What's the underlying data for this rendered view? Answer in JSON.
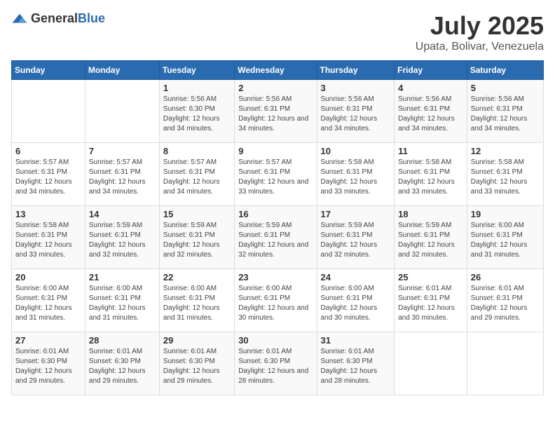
{
  "header": {
    "logo_general": "General",
    "logo_blue": "Blue",
    "month": "July 2025",
    "location": "Upata, Bolivar, Venezuela"
  },
  "weekdays": [
    "Sunday",
    "Monday",
    "Tuesday",
    "Wednesday",
    "Thursday",
    "Friday",
    "Saturday"
  ],
  "weeks": [
    [
      {
        "day": "",
        "info": ""
      },
      {
        "day": "",
        "info": ""
      },
      {
        "day": "1",
        "info": "Sunrise: 5:56 AM\nSunset: 6:30 PM\nDaylight: 12 hours and 34 minutes."
      },
      {
        "day": "2",
        "info": "Sunrise: 5:56 AM\nSunset: 6:31 PM\nDaylight: 12 hours and 34 minutes."
      },
      {
        "day": "3",
        "info": "Sunrise: 5:56 AM\nSunset: 6:31 PM\nDaylight: 12 hours and 34 minutes."
      },
      {
        "day": "4",
        "info": "Sunrise: 5:56 AM\nSunset: 6:31 PM\nDaylight: 12 hours and 34 minutes."
      },
      {
        "day": "5",
        "info": "Sunrise: 5:56 AM\nSunset: 6:31 PM\nDaylight: 12 hours and 34 minutes."
      }
    ],
    [
      {
        "day": "6",
        "info": "Sunrise: 5:57 AM\nSunset: 6:31 PM\nDaylight: 12 hours and 34 minutes."
      },
      {
        "day": "7",
        "info": "Sunrise: 5:57 AM\nSunset: 6:31 PM\nDaylight: 12 hours and 34 minutes."
      },
      {
        "day": "8",
        "info": "Sunrise: 5:57 AM\nSunset: 6:31 PM\nDaylight: 12 hours and 34 minutes."
      },
      {
        "day": "9",
        "info": "Sunrise: 5:57 AM\nSunset: 6:31 PM\nDaylight: 12 hours and 33 minutes."
      },
      {
        "day": "10",
        "info": "Sunrise: 5:58 AM\nSunset: 6:31 PM\nDaylight: 12 hours and 33 minutes."
      },
      {
        "day": "11",
        "info": "Sunrise: 5:58 AM\nSunset: 6:31 PM\nDaylight: 12 hours and 33 minutes."
      },
      {
        "day": "12",
        "info": "Sunrise: 5:58 AM\nSunset: 6:31 PM\nDaylight: 12 hours and 33 minutes."
      }
    ],
    [
      {
        "day": "13",
        "info": "Sunrise: 5:58 AM\nSunset: 6:31 PM\nDaylight: 12 hours and 33 minutes."
      },
      {
        "day": "14",
        "info": "Sunrise: 5:59 AM\nSunset: 6:31 PM\nDaylight: 12 hours and 32 minutes."
      },
      {
        "day": "15",
        "info": "Sunrise: 5:59 AM\nSunset: 6:31 PM\nDaylight: 12 hours and 32 minutes."
      },
      {
        "day": "16",
        "info": "Sunrise: 5:59 AM\nSunset: 6:31 PM\nDaylight: 12 hours and 32 minutes."
      },
      {
        "day": "17",
        "info": "Sunrise: 5:59 AM\nSunset: 6:31 PM\nDaylight: 12 hours and 32 minutes."
      },
      {
        "day": "18",
        "info": "Sunrise: 5:59 AM\nSunset: 6:31 PM\nDaylight: 12 hours and 32 minutes."
      },
      {
        "day": "19",
        "info": "Sunrise: 6:00 AM\nSunset: 6:31 PM\nDaylight: 12 hours and 31 minutes."
      }
    ],
    [
      {
        "day": "20",
        "info": "Sunrise: 6:00 AM\nSunset: 6:31 PM\nDaylight: 12 hours and 31 minutes."
      },
      {
        "day": "21",
        "info": "Sunrise: 6:00 AM\nSunset: 6:31 PM\nDaylight: 12 hours and 31 minutes."
      },
      {
        "day": "22",
        "info": "Sunrise: 6:00 AM\nSunset: 6:31 PM\nDaylight: 12 hours and 31 minutes."
      },
      {
        "day": "23",
        "info": "Sunrise: 6:00 AM\nSunset: 6:31 PM\nDaylight: 12 hours and 30 minutes."
      },
      {
        "day": "24",
        "info": "Sunrise: 6:00 AM\nSunset: 6:31 PM\nDaylight: 12 hours and 30 minutes."
      },
      {
        "day": "25",
        "info": "Sunrise: 6:01 AM\nSunset: 6:31 PM\nDaylight: 12 hours and 30 minutes."
      },
      {
        "day": "26",
        "info": "Sunrise: 6:01 AM\nSunset: 6:31 PM\nDaylight: 12 hours and 29 minutes."
      }
    ],
    [
      {
        "day": "27",
        "info": "Sunrise: 6:01 AM\nSunset: 6:30 PM\nDaylight: 12 hours and 29 minutes."
      },
      {
        "day": "28",
        "info": "Sunrise: 6:01 AM\nSunset: 6:30 PM\nDaylight: 12 hours and 29 minutes."
      },
      {
        "day": "29",
        "info": "Sunrise: 6:01 AM\nSunset: 6:30 PM\nDaylight: 12 hours and 29 minutes."
      },
      {
        "day": "30",
        "info": "Sunrise: 6:01 AM\nSunset: 6:30 PM\nDaylight: 12 hours and 28 minutes."
      },
      {
        "day": "31",
        "info": "Sunrise: 6:01 AM\nSunset: 6:30 PM\nDaylight: 12 hours and 28 minutes."
      },
      {
        "day": "",
        "info": ""
      },
      {
        "day": "",
        "info": ""
      }
    ]
  ]
}
